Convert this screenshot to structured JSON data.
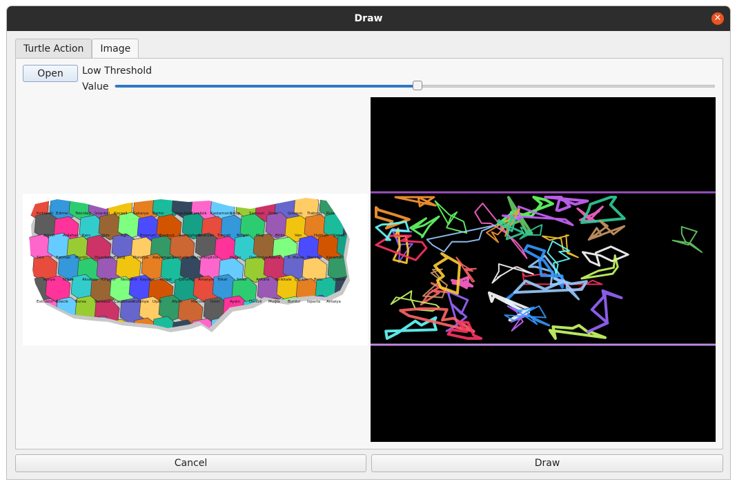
{
  "window": {
    "title": "Draw",
    "close_icon": "close-icon"
  },
  "tabs": [
    {
      "label": "Turtle Action",
      "active": false
    },
    {
      "label": "Image",
      "active": true
    }
  ],
  "image_tab": {
    "open_label": "Open",
    "threshold_label": "Low Threshold",
    "value_label": "Value",
    "slider_level": 0.505
  },
  "map_labels": [
    "Kırklareli",
    "Edirne",
    "Tekirdağ",
    "İstanbul",
    "Kocaeli",
    "Sakarya",
    "Bartın",
    "Zonguldak",
    "Karabük",
    "Kastamonu",
    "Sinop",
    "Samsun",
    "Ordu",
    "Giresun",
    "Trabzon",
    "Rize",
    "Artvin",
    "Ardahan",
    "Kars",
    "Iğdır",
    "Ağrı",
    "Erzurum",
    "Bayburt",
    "Gümüşhane",
    "Erzincan",
    "Tunceli",
    "Bingöl",
    "Muş",
    "Bitlis",
    "Van",
    "Hakkari",
    "Şırnak",
    "Siirt",
    "Batman",
    "Mardin",
    "Diyarbakır",
    "Elazığ",
    "Malatya",
    "Adıyaman",
    "Şanlıurfa",
    "Gaziantep",
    "Kilis",
    "Hatay",
    "Osmaniye",
    "Adana",
    "K. Maraş",
    "Mersin",
    "Karaman",
    "Konya",
    "Niğde",
    "Aksaray",
    "Kırşehir",
    "Nevşehir",
    "Kayseri",
    "Yozgat",
    "Çorum",
    "Amasya",
    "Tokat",
    "Sivas",
    "Ankara",
    "Kırıkkale",
    "Çankırı",
    "Bolu",
    "Düzce",
    "Eskişehir",
    "Bilecik",
    "Bursa",
    "Balıkesir",
    "Çanakkale",
    "Kütahya",
    "Uşak",
    "Afyon",
    "Manisa",
    "İzmir",
    "Aydın",
    "Denizli",
    "Muğla",
    "Burdur",
    "Isparta",
    "Antalya"
  ],
  "buttons": {
    "cancel": "Cancel",
    "draw": "Draw"
  }
}
